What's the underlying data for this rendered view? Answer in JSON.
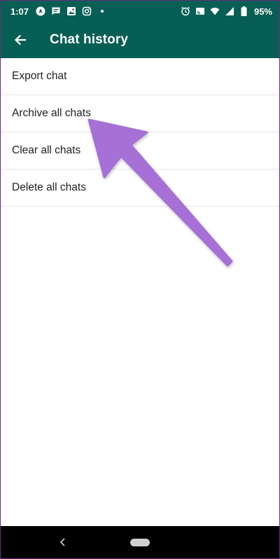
{
  "status_bar": {
    "time": "1:07",
    "battery_percent": "95%",
    "left_icons": [
      "navigation-icon",
      "message-icon",
      "gallery-icon",
      "instagram-icon",
      "dot-icon"
    ],
    "right_icons": [
      "alarm-icon",
      "cast-icon",
      "wifi-icon",
      "signal-icon",
      "battery-icon"
    ]
  },
  "app_bar": {
    "back_icon": "arrow-back-icon",
    "title": "Chat history",
    "color": "#075e54"
  },
  "menu": {
    "items": [
      {
        "label": "Export chat"
      },
      {
        "label": "Archive all chats"
      },
      {
        "label": "Clear all chats"
      },
      {
        "label": "Delete all chats"
      }
    ]
  },
  "annotation": {
    "type": "arrow",
    "points_to": "Archive all chats",
    "color": "#a66fd6"
  },
  "nav_bar": {
    "icons": [
      "nav-back-icon",
      "nav-home-pill"
    ]
  }
}
